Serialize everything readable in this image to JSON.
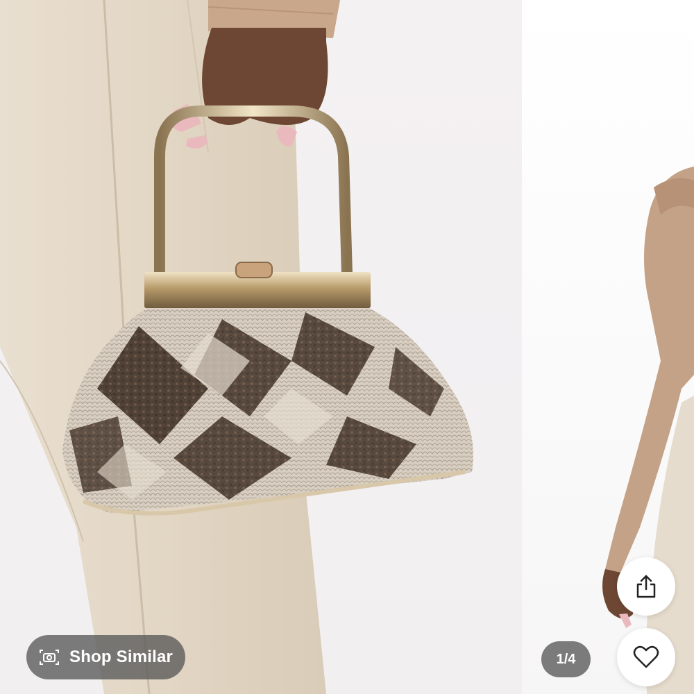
{
  "gallery": {
    "current_photo": "snakeskin-handbag-photo",
    "next_photo": "model-blouse-photo"
  },
  "actions": {
    "shop_similar_label": "Shop Similar",
    "camera_icon": "camera-icon",
    "share_icon": "share-icon",
    "favorite_icon": "heart-icon"
  },
  "pager": {
    "label": "1/4"
  },
  "colors": {
    "pill_bg": "#585858",
    "button_bg": "#ffffff",
    "icon": "#222222"
  }
}
